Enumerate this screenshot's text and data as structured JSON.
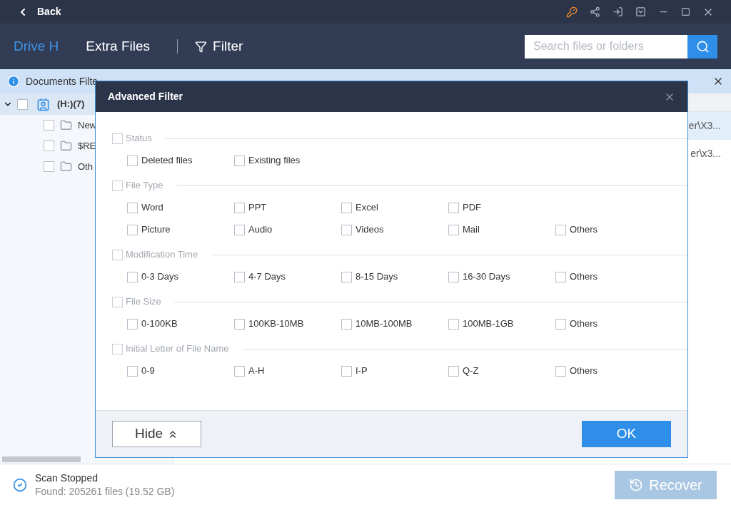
{
  "top_bar": {
    "back": "Back"
  },
  "nav": {
    "tabs": [
      {
        "label": "Drive H",
        "selected": true
      },
      {
        "label": "Extra Files",
        "selected": false
      }
    ],
    "filter": "Filter",
    "search": {
      "placeholder": "Search files or folders"
    }
  },
  "info_bar": {
    "text": "Documents Filte"
  },
  "tree": [
    {
      "label": "(H:)(7)",
      "expanded": true,
      "checked": false,
      "selected": true,
      "children": [
        {
          "label": "New",
          "checked": false,
          "selected": false
        },
        {
          "label": "$RE",
          "checked": false,
          "selected": false
        },
        {
          "label": "Oth",
          "checked": false,
          "selected": false
        }
      ]
    }
  ],
  "list_rows": [
    {
      "text": "er\\X3...",
      "selected": true
    },
    {
      "text": "er\\x3...",
      "selected": false
    }
  ],
  "dialog": {
    "title": "Advanced Filter",
    "groups": [
      {
        "label": "Status",
        "checked": false,
        "rows": [
          [
            {
              "label": "Deleted files",
              "checked": false
            },
            {
              "label": "Existing files",
              "checked": false
            }
          ]
        ]
      },
      {
        "label": "File Type",
        "checked": false,
        "rows": [
          [
            {
              "label": "Word",
              "checked": false
            },
            {
              "label": "PPT",
              "checked": false
            },
            {
              "label": "Excel",
              "checked": false
            },
            {
              "label": "PDF",
              "checked": false
            }
          ],
          [
            {
              "label": "Picture",
              "checked": false
            },
            {
              "label": "Audio",
              "checked": false
            },
            {
              "label": "Videos",
              "checked": false
            },
            {
              "label": "Mail",
              "checked": false
            },
            {
              "label": "Others",
              "checked": false
            }
          ]
        ]
      },
      {
        "label": "Modification Time",
        "checked": false,
        "rows": [
          [
            {
              "label": "0-3 Days",
              "checked": false
            },
            {
              "label": "4-7 Days",
              "checked": false
            },
            {
              "label": "8-15 Days",
              "checked": false
            },
            {
              "label": "16-30 Days",
              "checked": false
            },
            {
              "label": "Others",
              "checked": false
            }
          ]
        ]
      },
      {
        "label": "File Size",
        "checked": false,
        "rows": [
          [
            {
              "label": "0-100KB",
              "checked": false
            },
            {
              "label": "100KB-10MB",
              "checked": false
            },
            {
              "label": "10MB-100MB",
              "checked": false
            },
            {
              "label": "100MB-1GB",
              "checked": false
            },
            {
              "label": "Others",
              "checked": false
            }
          ]
        ]
      },
      {
        "label": "Initial Letter of File Name",
        "checked": false,
        "rows": [
          [
            {
              "label": "0-9",
              "checked": false
            },
            {
              "label": "A-H",
              "checked": false
            },
            {
              "label": "I-P",
              "checked": false
            },
            {
              "label": "Q-Z",
              "checked": false
            },
            {
              "label": "Others",
              "checked": false
            }
          ]
        ]
      }
    ],
    "hide": "Hide",
    "ok": "OK"
  },
  "status": {
    "title": "Scan Stopped",
    "detail": "Found: 205261 files (19.52 GB)",
    "recover": {
      "label": "Recover",
      "disabled": true
    }
  }
}
